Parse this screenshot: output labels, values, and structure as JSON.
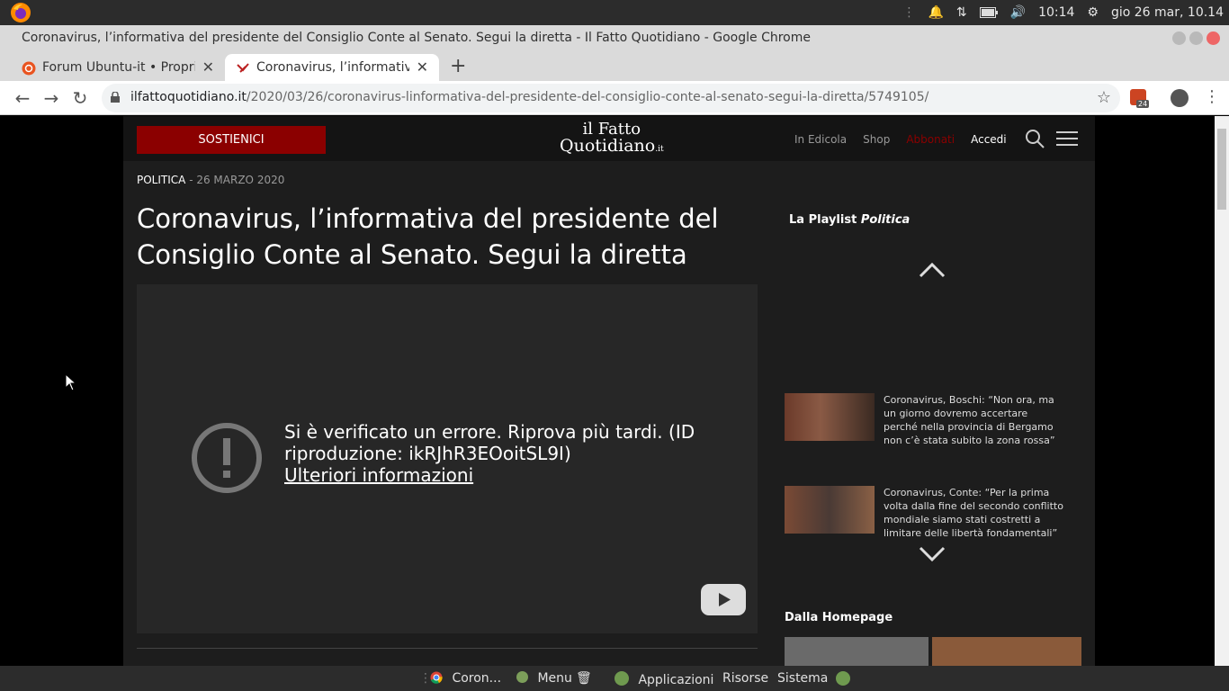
{
  "system": {
    "time": "10:14",
    "date": "gio 26 mar, 10.14"
  },
  "window": {
    "title": "Coronavirus, l’informativa del presidente del Consiglio Conte al Senato. Segui la diretta - Il Fatto Quotidiano - Google Chrome"
  },
  "tabs": [
    {
      "label": "Forum Ubuntu-it • Propri i"
    },
    {
      "label": "Coronavirus, l’informativ"
    }
  ],
  "omnibox": {
    "domain": "ilfattoquotidiano.it",
    "path": "/2020/03/26/coronavirus-linformativa-del-presidente-del-consiglio-conte-al-senato-segui-la-diretta/5749105/",
    "ext_badge": "24"
  },
  "site": {
    "sostienici": "SOSTIENICI",
    "logo_line1": "il Fatto",
    "logo_line2": "Quotidiano",
    "logo_it": ".it",
    "links": [
      "In Edicola",
      "Shop",
      "Abbonati",
      "Accedi"
    ]
  },
  "article": {
    "section": "POLITICA",
    "date": "- 26 MARZO 2020",
    "title": "Coronavirus, l’informativa del presidente del Consiglio Conte al Senato. Segui la diretta"
  },
  "player": {
    "error": "Si è verificato un errore. Riprova più tardi. (ID riproduzione: ikRJhR3EOoitSL9I)",
    "more": "Ulteriori informazioni"
  },
  "playlist": {
    "label": "La Playlist",
    "category": "Politica",
    "items": [
      "Coronavirus, Boschi: “Non ora, ma un giorno dovremo accertare perché nella provincia di Bergamo non c’è stata subito la zona rossa”",
      "Coronavirus, Conte: “Per la prima volta dalla fine del secondo conflitto mondiale siamo stati costretti a limitare delle libertà fondamentali”"
    ]
  },
  "homepage_label": "Dalla Homepage",
  "panel": {
    "task": "Coron...",
    "menu": "Menu",
    "apps": "Applicazioni",
    "resources": "Risorse",
    "system": "Sistema"
  },
  "colors": {
    "brand_red": "#8b0000",
    "page_bg": "#1d1d1d"
  }
}
